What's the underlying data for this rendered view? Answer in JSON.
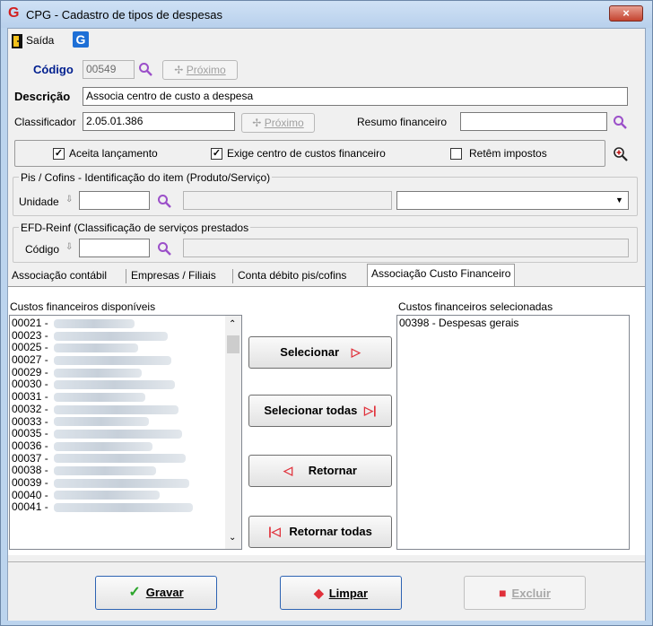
{
  "window": {
    "title": "CPG - Cadastro de tipos de despesas",
    "close_glyph": "×"
  },
  "toolbar": {
    "exit_label": "Saída"
  },
  "codigo": {
    "label": "Código",
    "value": "00549",
    "next_label": "Próximo"
  },
  "descricao": {
    "label": "Descrição",
    "value": "Associa centro de custo a despesa"
  },
  "classificador": {
    "label": "Classificador",
    "value": "2.05.01.386",
    "next_label": "Próximo"
  },
  "resumo": {
    "label": "Resumo financeiro",
    "value": ""
  },
  "checks": [
    {
      "label": "Aceita lançamento",
      "checked": true
    },
    {
      "label": "Exige centro de custos financeiro",
      "checked": true
    },
    {
      "label": "Retêm impostos",
      "checked": false
    }
  ],
  "pis": {
    "title": "Pis / Cofins - Identificação do item (Produto/Serviço)",
    "unit_label": "Unidade"
  },
  "efd": {
    "title": "EFD-Reinf (Classificação de serviços prestados",
    "code_label": "Código"
  },
  "tabs": [
    {
      "label": "Associação contábil"
    },
    {
      "label": "Empresas / Filiais"
    },
    {
      "label": "Conta débito pis/cofins"
    },
    {
      "label": "Associação Custo Financeiro"
    }
  ],
  "available": {
    "label": "Custos financeiros disponíveis",
    "items": [
      "00021 -",
      "00023 -",
      "00025 -",
      "00027 -",
      "00029 -",
      "00030 -",
      "00031 -",
      "00032 -",
      "00033 -",
      "00035 -",
      "00036 -",
      "00037 -",
      "00038 -",
      "00039 -",
      "00040 -",
      "00041 -"
    ]
  },
  "selected": {
    "label": "Custos financeiros selecionadas",
    "items": [
      "00398 - Despesas gerais"
    ]
  },
  "move_buttons": {
    "select": "Selecionar",
    "select_all": "Selecionar todas",
    "return": "Retornar",
    "return_all": "Retornar todas"
  },
  "actions": {
    "save": "Gravar",
    "clear": "Limpar",
    "delete": "Excluir"
  },
  "colors": {
    "accent_red": "#e0303a",
    "window_blue": "#bcd4ee",
    "search_purple": "#9b4fc9"
  }
}
